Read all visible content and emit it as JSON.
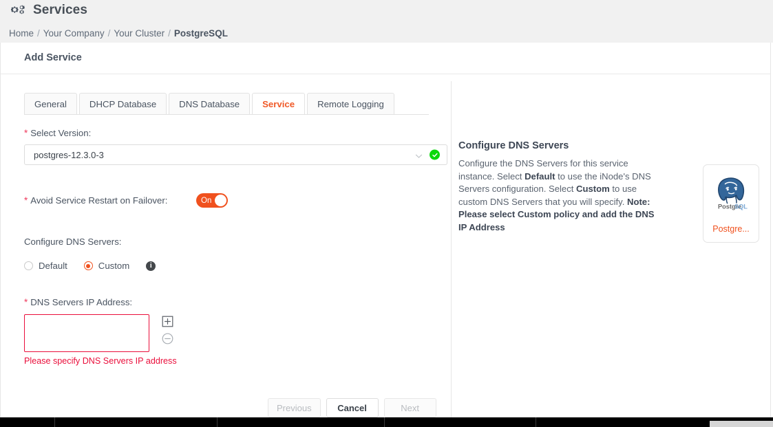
{
  "header": {
    "icon": "cogs-icon",
    "title": "Services",
    "breadcrumb": [
      {
        "label": "Home",
        "current": false
      },
      {
        "label": "Your Company",
        "current": false
      },
      {
        "label": "Your Cluster",
        "current": false
      },
      {
        "label": "PostgreSQL",
        "current": true
      }
    ],
    "breadcrumb_separator": "/"
  },
  "card": {
    "title": "Add Service"
  },
  "tabs": [
    {
      "label": "General",
      "active": false
    },
    {
      "label": "DHCP Database",
      "active": false
    },
    {
      "label": "DNS Database",
      "active": false
    },
    {
      "label": "Service",
      "active": true
    },
    {
      "label": "Remote Logging",
      "active": false
    }
  ],
  "form": {
    "select_version": {
      "label": "Select Version",
      "required_mark": "*",
      "colon": ":",
      "value": "postgres-12.3.0-3",
      "valid": true,
      "chevron_icon": "chevron-down-icon",
      "valid_icon": "check-circle-icon"
    },
    "avoid_restart": {
      "label": "Avoid Service Restart on Failover",
      "required_mark": "*",
      "colon": ":",
      "toggle_state": "On"
    },
    "configure_dns": {
      "label": "Configure DNS Servers",
      "colon": ":",
      "options": [
        {
          "label": "Default",
          "selected": false
        },
        {
          "label": "Custom",
          "selected": true
        }
      ],
      "info_icon": "info-icon",
      "info_glyph": "i"
    },
    "dns_ip": {
      "label": "DNS Servers IP Address",
      "required_mark": "*",
      "colon": ":",
      "value": "",
      "placeholder": "",
      "error": "Please specify DNS Servers IP address",
      "add_icon": "plus-square-icon",
      "remove_icon": "minus-circle-icon"
    }
  },
  "buttons": [
    {
      "label": "Previous",
      "disabled": true
    },
    {
      "label": "Cancel",
      "disabled": false
    },
    {
      "label": "Next",
      "disabled": true
    }
  ],
  "help": {
    "title": "Configure DNS Servers",
    "paragraph_parts": [
      {
        "text": "Configure the DNS Servers for this service instance. Select ",
        "bold": false
      },
      {
        "text": "Default",
        "bold": true
      },
      {
        "text": " to use the iNode's DNS Servers configuration. Select ",
        "bold": false
      },
      {
        "text": "Custom",
        "bold": true
      },
      {
        "text": " to use custom DNS Servers that you will specify. ",
        "bold": false
      },
      {
        "text": "Note: Please select Custom policy and add the DNS IP Address",
        "bold": true
      }
    ]
  },
  "service_tile": {
    "logo_icon": "postgresql-logo-icon",
    "logo_text": "PostgreSQL",
    "caption": "Postgre..."
  },
  "colors": {
    "accent_orange": "#f0511e",
    "error_red": "#ea0d3a",
    "required_red": "#ef3a5d",
    "success_green": "#0bd80b",
    "text_dark": "#4a5461",
    "header_bg": "#f1f1f1"
  }
}
